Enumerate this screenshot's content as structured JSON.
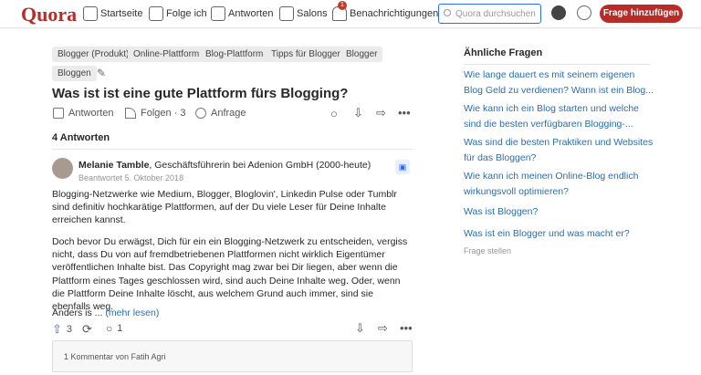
{
  "header": {
    "logo": "Quora",
    "nav": [
      {
        "label": "Startseite",
        "icon": "home-icon"
      },
      {
        "label": "Folge ich",
        "icon": "list-icon"
      },
      {
        "label": "Antworten",
        "icon": "pencil-icon"
      },
      {
        "label": "Salons",
        "icon": "people-icon"
      },
      {
        "label": "Benachrichtigungen",
        "icon": "bell-icon"
      }
    ],
    "notification_count": "1",
    "search_placeholder": "Quora durchsuchen",
    "ask_button": "Frage hinzufügen"
  },
  "question": {
    "tags": [
      "Blogger (Produkt)",
      "Online-Plattform",
      "Blog-Plattform",
      "Tipps für Blogger",
      "Blogger",
      "Bloggen"
    ],
    "title": "Was ist ist eine gute Plattform fürs Blogging?",
    "actions": {
      "answer": "Antworten",
      "follow": "Folgen · 3",
      "request": "Anfrage"
    },
    "answer_count": "4 Antworten"
  },
  "answer": {
    "author": "Melanie Tamble",
    "credential": ", Geschäftsführerin bei Adenion GmbH (2000-heute)",
    "date": "Beantwortet 5. Oktober 2018",
    "paragraphs": [
      "Blogging-Netzwerke wie Medium, Blogger, Bloglovin', Linkedin Pulse oder Tumblr sind definitiv hochkarätige Plattformen, auf der Du viele Leser für Deine Inhalte erreichen kannst.",
      "Doch bevor Du erwägst, Dich für ein ein Blogging-Netzwerk zu entscheiden, vergiss nicht, dass Du von auf fremdbetriebenen Plattformen nicht wirklich Eigentümer veröffentlichen Inhalte bist. Das Copyright mag zwar bei Dir liegen, aber wenn die Plattform eines Tages geschlossen wird, sind auch Deine Inhalte weg. Oder, wenn die Plattform Deine Inhalte löscht, aus welchem Grund auch immer, sind sie ebenfalls weg."
    ],
    "teaser": "Anders is ...",
    "more": "(mehr lesen)",
    "upvotes": "3",
    "comments": "1",
    "comment_box": "1 Kommentar von Fatih Agri"
  },
  "sidebar": {
    "heading": "Ähnliche Fragen",
    "questions": [
      "Wie lange dauert es mit seinem eigenen Blog Geld zu verdienen? Wann ist ein Blog...",
      "Wie kann ich ein Blog starten und welche sind die besten verfügbaren Blogging-...",
      "Was sind die besten Praktiken und Websites für das Bloggen?",
      "Wie kann ich meinen Online-Blog endlich wirkungsvoll optimieren?",
      "Was ist Bloggen?",
      "Was ist ein Blogger und was macht er?"
    ],
    "ask": "Frage stellen"
  },
  "colors": {
    "brand": "#b92b27",
    "link": "#2b6dad",
    "upvote": "#2e69ff"
  }
}
